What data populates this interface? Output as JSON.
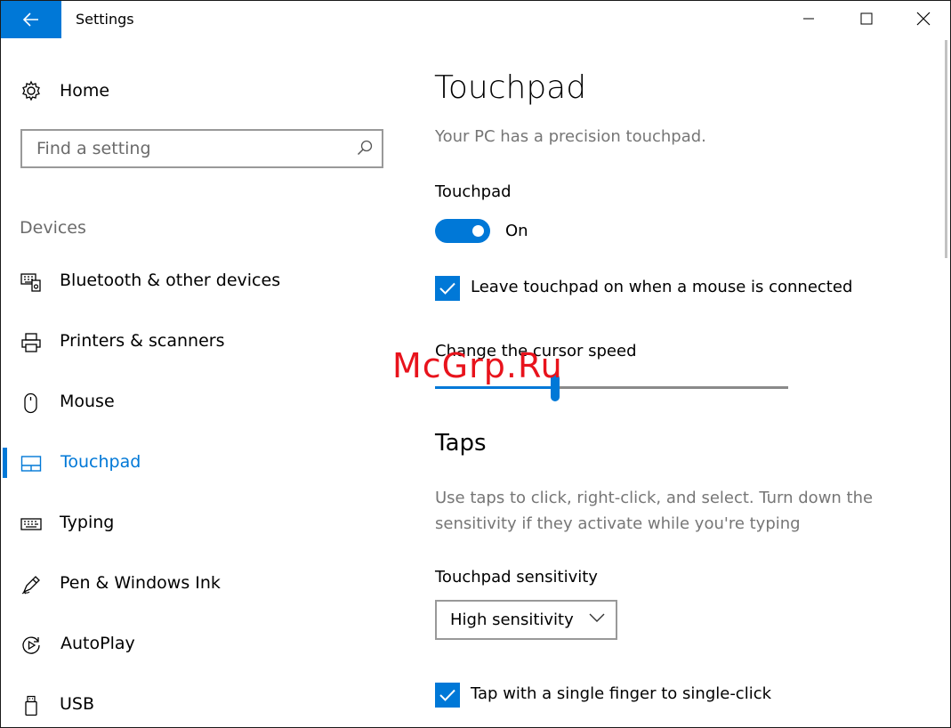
{
  "window": {
    "title": "Settings",
    "accent": "#0078d7"
  },
  "sidebar": {
    "home_label": "Home",
    "search_placeholder": "Find a setting",
    "section_label": "Devices",
    "items": [
      {
        "label": "Bluetooth & other devices",
        "icon": "bluetooth-devices-icon"
      },
      {
        "label": "Printers & scanners",
        "icon": "printer-icon"
      },
      {
        "label": "Mouse",
        "icon": "mouse-icon"
      },
      {
        "label": "Touchpad",
        "icon": "touchpad-icon",
        "active": true
      },
      {
        "label": "Typing",
        "icon": "keyboard-icon"
      },
      {
        "label": "Pen & Windows Ink",
        "icon": "pen-icon"
      },
      {
        "label": "AutoPlay",
        "icon": "autoplay-icon"
      },
      {
        "label": "USB",
        "icon": "usb-icon"
      }
    ]
  },
  "main": {
    "title": "Touchpad",
    "description": "Your PC has a precision touchpad.",
    "touchpad_label": "Touchpad",
    "toggle_state": "On",
    "leave_on_label": "Leave touchpad on when a mouse is connected",
    "leave_on_checked": true,
    "cursor_speed_label": "Change the cursor speed",
    "cursor_speed_fraction": 0.34,
    "taps_heading": "Taps",
    "taps_description": "Use taps to click, right-click, and select. Turn down the sensitivity if they activate while you're typing",
    "sensitivity_label": "Touchpad sensitivity",
    "sensitivity_value": "High sensitivity",
    "single_tap_label": "Tap with a single finger to single-click",
    "single_tap_checked": true
  },
  "watermark": "McGrp.Ru"
}
